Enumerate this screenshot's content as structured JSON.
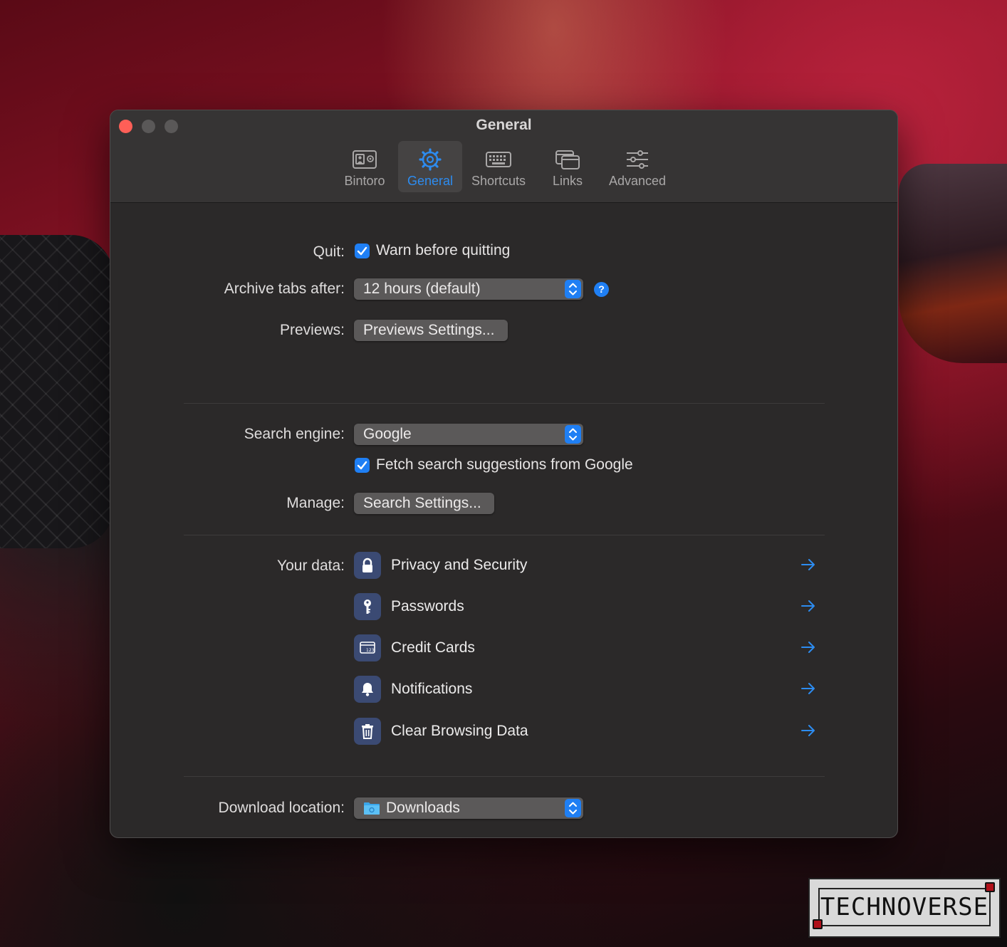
{
  "window": {
    "title": "General",
    "tabs": [
      {
        "label": "Bintoro",
        "icon": "contact-card-icon"
      },
      {
        "label": "General",
        "icon": "gear-icon",
        "active": true
      },
      {
        "label": "Shortcuts",
        "icon": "keyboard-icon"
      },
      {
        "label": "Links",
        "icon": "windows-icon"
      },
      {
        "label": "Advanced",
        "icon": "sliders-icon"
      }
    ]
  },
  "general": {
    "quit_label": "Quit:",
    "warn_before_quitting": {
      "label": "Warn before quitting",
      "checked": true
    },
    "archive_label": "Archive tabs after:",
    "archive_value": "12 hours (default)",
    "help_glyph": "?",
    "previews_label": "Previews:",
    "previews_button": "Previews Settings..."
  },
  "search": {
    "engine_label": "Search engine:",
    "engine_value": "Google",
    "fetch_suggestions": {
      "label": "Fetch search suggestions from Google",
      "checked": true
    },
    "manage_label": "Manage:",
    "manage_button": "Search Settings..."
  },
  "your_data": {
    "label": "Your data:",
    "items": [
      {
        "label": "Privacy and Security",
        "icon": "lock-icon"
      },
      {
        "label": "Passwords",
        "icon": "key-icon"
      },
      {
        "label": "Credit Cards",
        "icon": "credit-card-icon"
      },
      {
        "label": "Notifications",
        "icon": "bell-icon"
      },
      {
        "label": "Clear Browsing Data",
        "icon": "trash-icon"
      }
    ]
  },
  "download": {
    "label": "Download location:",
    "value": "Downloads",
    "icon": "folder-icon"
  },
  "watermark": {
    "text": "TECHNOVERSE"
  },
  "colors": {
    "accent": "#1f7ff4",
    "window_bg": "#2b2929",
    "toolbar_bg": "#363434",
    "close": "#fe5f57"
  }
}
